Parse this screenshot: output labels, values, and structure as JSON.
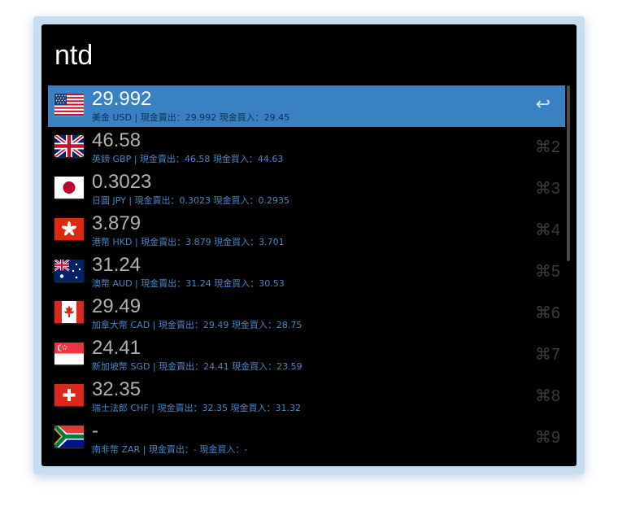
{
  "query": "ntd",
  "results": [
    {
      "title": "29.992",
      "subtitle": "美金 USD | 現金賣出：29.992 現金買入：29.45",
      "shortcut": "↩",
      "flag": "us-flag-icon"
    },
    {
      "title": "46.58",
      "subtitle": "英鎊 GBP | 現金賣出：46.58 現金買入：44.63",
      "shortcut": "⌘2",
      "flag": "uk-flag-icon"
    },
    {
      "title": "0.3023",
      "subtitle": "日圓 JPY | 現金賣出：0.3023 現金買入：0.2935",
      "shortcut": "⌘3",
      "flag": "japan-flag-icon"
    },
    {
      "title": "3.879",
      "subtitle": "港幣 HKD | 現金賣出：3.879 現金買入：3.701",
      "shortcut": "⌘4",
      "flag": "hong-kong-flag-icon"
    },
    {
      "title": "31.24",
      "subtitle": "澳幣 AUD | 現金賣出：31.24 現金買入：30.53",
      "shortcut": "⌘5",
      "flag": "australia-flag-icon"
    },
    {
      "title": "29.49",
      "subtitle": "加拿大幣 CAD | 現金賣出：29.49 現金買入：28.75",
      "shortcut": "⌘6",
      "flag": "canada-flag-icon"
    },
    {
      "title": "24.41",
      "subtitle": "新加坡幣 SGD | 現金賣出：24.41 現金買入：23.59",
      "shortcut": "⌘7",
      "flag": "singapore-flag-icon"
    },
    {
      "title": "32.35",
      "subtitle": "瑞士法郎 CHF | 現金賣出：32.35 現金買入：31.32",
      "shortcut": "⌘8",
      "flag": "switzerland-flag-icon"
    },
    {
      "title": "-",
      "subtitle": "南非幣 ZAR | 現金賣出：- 現金買入：-",
      "shortcut": "⌘9",
      "flag": "south-africa-flag-icon"
    }
  ],
  "colors": {
    "selection": "#3a81c4",
    "subtitle": "#4b84c4",
    "title": "#b0b0b0",
    "background": "#000000",
    "frame": "#c7def0"
  }
}
